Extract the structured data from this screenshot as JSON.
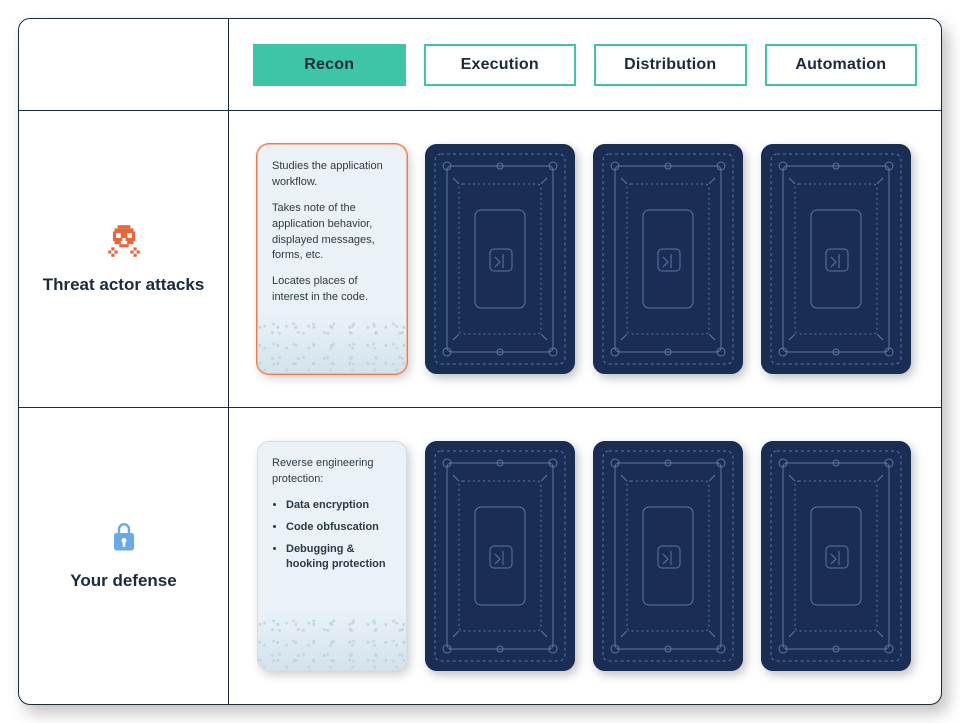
{
  "tabs": [
    {
      "label": "Recon",
      "active": true
    },
    {
      "label": "Execution",
      "active": false
    },
    {
      "label": "Distribution",
      "active": false
    },
    {
      "label": "Automation",
      "active": false
    }
  ],
  "rows": {
    "attack": {
      "label": "Threat actor attacks",
      "card": {
        "p1": "Studies the application workflow.",
        "p2": "Takes note of the application behavior, displayed messages, forms, etc.",
        "p3": "Locates places of interest in the code."
      }
    },
    "defense": {
      "label": "Your defense",
      "card": {
        "heading": "Reverse engineering protection:",
        "items": [
          "Data encryption",
          "Code obfuscation",
          "Debugging & hooking protection"
        ]
      }
    }
  },
  "icons": {
    "skull": "skull-icon",
    "lock": "lock-icon",
    "cardback": "card-back-pattern"
  }
}
